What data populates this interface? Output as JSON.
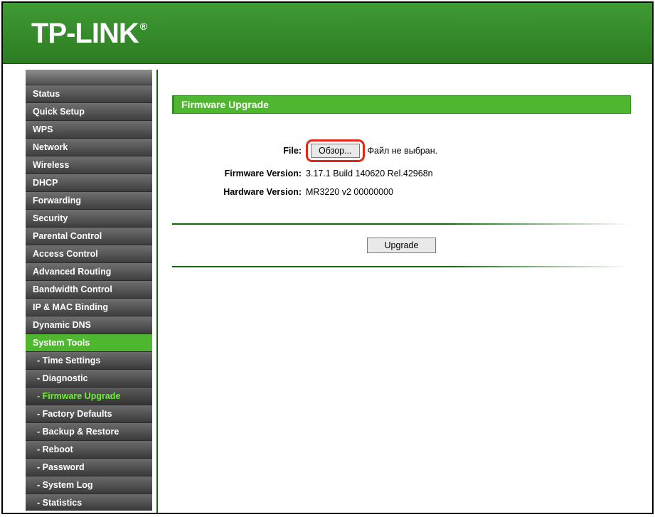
{
  "brand": {
    "name": "TP-LINK",
    "reg": "®"
  },
  "sidebar": {
    "items": [
      {
        "label": "Status",
        "kind": "top"
      },
      {
        "label": "Quick Setup",
        "kind": "top"
      },
      {
        "label": "WPS",
        "kind": "top"
      },
      {
        "label": "Network",
        "kind": "top"
      },
      {
        "label": "Wireless",
        "kind": "top"
      },
      {
        "label": "DHCP",
        "kind": "top"
      },
      {
        "label": "Forwarding",
        "kind": "top"
      },
      {
        "label": "Security",
        "kind": "top"
      },
      {
        "label": "Parental Control",
        "kind": "top"
      },
      {
        "label": "Access Control",
        "kind": "top"
      },
      {
        "label": "Advanced Routing",
        "kind": "top"
      },
      {
        "label": "Bandwidth Control",
        "kind": "top"
      },
      {
        "label": "IP & MAC Binding",
        "kind": "top"
      },
      {
        "label": "Dynamic DNS",
        "kind": "top"
      },
      {
        "label": "System Tools",
        "kind": "top",
        "active": true
      },
      {
        "label": "- Time Settings",
        "kind": "sub"
      },
      {
        "label": "- Diagnostic",
        "kind": "sub"
      },
      {
        "label": "- Firmware Upgrade",
        "kind": "sub",
        "current": true
      },
      {
        "label": "- Factory Defaults",
        "kind": "sub"
      },
      {
        "label": "- Backup & Restore",
        "kind": "sub"
      },
      {
        "label": "- Reboot",
        "kind": "sub"
      },
      {
        "label": "- Password",
        "kind": "sub"
      },
      {
        "label": "- System Log",
        "kind": "sub"
      },
      {
        "label": "- Statistics",
        "kind": "sub"
      }
    ]
  },
  "page": {
    "title": "Firmware Upgrade",
    "file_label": "File:",
    "browse_label": "Обзор...",
    "file_status": "Файл не выбран.",
    "fw_label": "Firmware Version:",
    "fw_value": "3.17.1 Build 140620 Rel.42968n",
    "hw_label": "Hardware Version:",
    "hw_value": "MR3220 v2 00000000",
    "upgrade_label": "Upgrade"
  }
}
